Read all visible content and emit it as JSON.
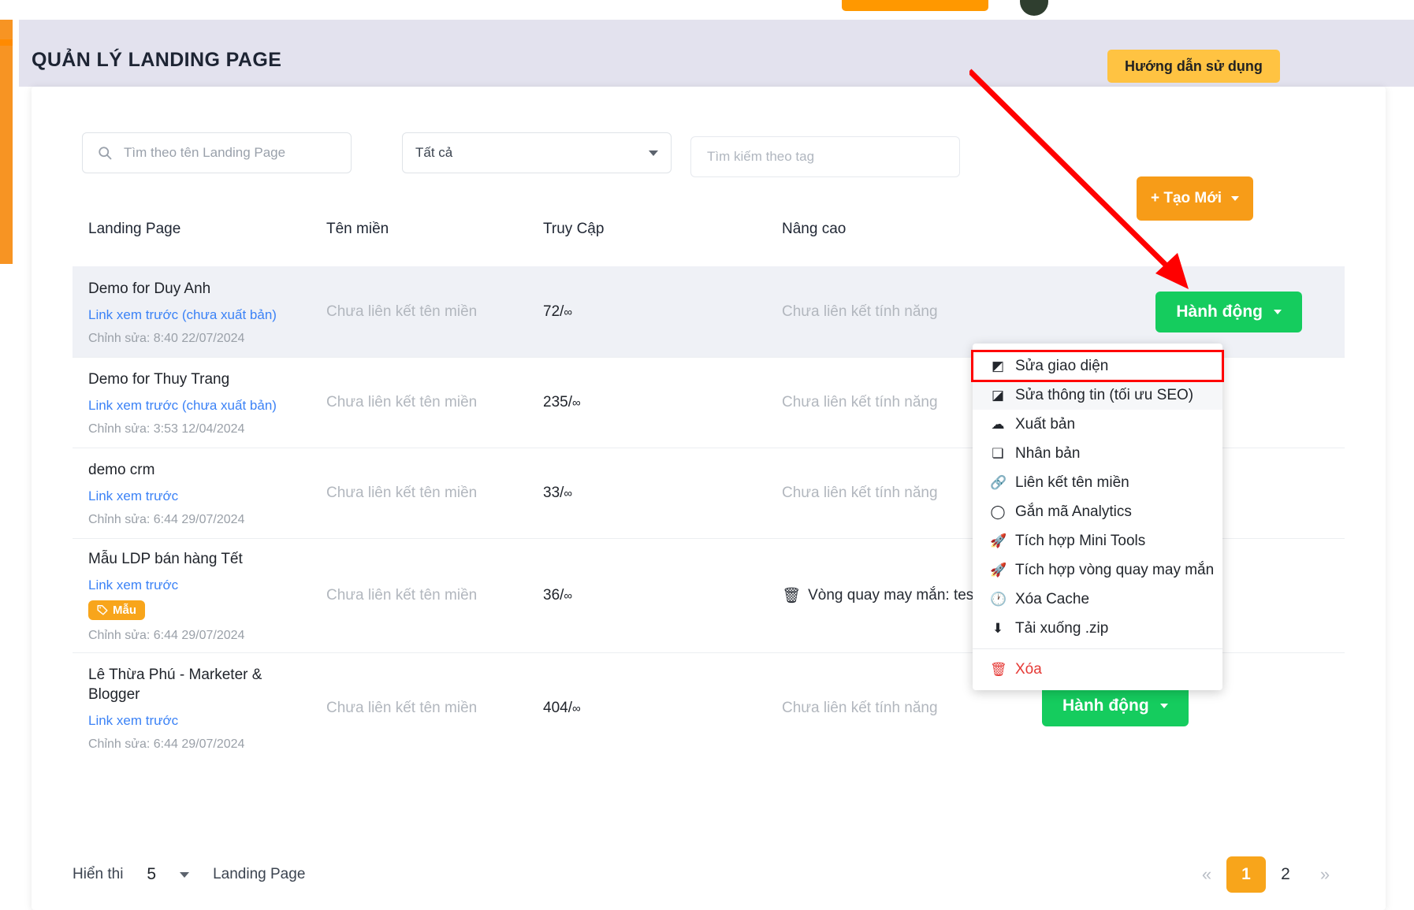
{
  "header": {
    "title": "QUẢN LÝ LANDING PAGE",
    "guide_button": "Hướng dẫn sử dụng"
  },
  "filters": {
    "search_placeholder": "Tìm theo tên Landing Page",
    "search_value": "",
    "search_icon": "search-icon",
    "select_value": "Tất cả",
    "tag_placeholder": "Tìm kiếm theo tag",
    "tag_value": "",
    "create_button": "+ Tạo Mới"
  },
  "table": {
    "columns": [
      "Landing Page",
      "Tên miền",
      "Truy Cập",
      "Nâng cao"
    ],
    "action_button": "Hành động",
    "rows": [
      {
        "name": "Demo for Duy Anh",
        "link": "Link xem trước (chưa xuất bản)",
        "edited": "Chỉnh sửa: 8:40 22/07/2024",
        "domain": "Chưa liên kết tên miền",
        "visits": "72",
        "visits_limit": "∞",
        "advanced": "Chưa liên kết tính năng",
        "tag": "",
        "active": true
      },
      {
        "name": "Demo for Thuy Trang",
        "link": "Link xem trước (chưa xuất bản)",
        "edited": "Chỉnh sửa: 3:53 12/04/2024",
        "domain": "Chưa liên kết tên miền",
        "visits": "235",
        "visits_limit": "∞",
        "advanced": "Chưa liên kết tính năng",
        "tag": "",
        "active": false
      },
      {
        "name": "demo crm",
        "link": "Link xem trước",
        "edited": "Chỉnh sửa: 6:44 29/07/2024",
        "domain": "Chưa liên kết tên miền",
        "visits": "33",
        "visits_limit": "∞",
        "advanced": "Chưa liên kết tính năng",
        "tag": "",
        "active": false
      },
      {
        "name": "Mẫu LDP bán hàng Tết",
        "link": "Link xem trước",
        "edited": "Chỉnh sửa: 6:44 29/07/2024",
        "domain": "Chưa liên kết tên miền",
        "visits": "36",
        "visits_limit": "∞",
        "advanced": "Vòng quay may mắn: test",
        "advanced_icon": "trash-icon",
        "tag": "Mẫu",
        "active": false
      },
      {
        "name": "Lê Thừa Phú - Marketer & Blogger",
        "link": "Link xem trước",
        "edited": "Chỉnh sửa: 6:44 29/07/2024",
        "domain": "Chưa liên kết tên miền",
        "visits": "404",
        "visits_limit": "∞",
        "advanced": "Chưa liên kết tính năng",
        "tag": "",
        "active": false
      }
    ]
  },
  "menu": {
    "items": [
      {
        "label": "Sửa giao diện",
        "icon": "edit-interface-icon",
        "highlighted": true
      },
      {
        "label": "Sửa thông tin (tối ưu SEO)",
        "icon": "edit-info-icon",
        "hovered": true
      },
      {
        "label": "Xuất bản",
        "icon": "cloud-upload-icon"
      },
      {
        "label": "Nhân bản",
        "icon": "duplicate-icon"
      },
      {
        "label": "Liên kết tên miền",
        "icon": "link-icon"
      },
      {
        "label": "Gắn mã Analytics",
        "icon": "analytics-icon"
      },
      {
        "label": "Tích hợp Mini Tools",
        "icon": "rocket-icon"
      },
      {
        "label": "Tích hợp vòng quay may mắn",
        "icon": "rocket-icon"
      },
      {
        "label": "Xóa Cache",
        "icon": "clock-icon"
      },
      {
        "label": "Tải xuống .zip",
        "icon": "download-icon"
      }
    ],
    "danger_item": {
      "label": "Xóa",
      "icon": "trash-icon"
    }
  },
  "footer": {
    "show_label": "Hiển thi",
    "show_count": "5",
    "show_unit": "Landing Page",
    "pagination": {
      "first": "«",
      "last": "»",
      "pages": [
        "1",
        "2"
      ],
      "current": "1"
    }
  },
  "colors": {
    "accent_orange": "#f79c18",
    "action_green": "#15cc5e",
    "guide_yellow": "#ffc342",
    "link_blue": "#3b82f6",
    "annotation_red": "#ff0000",
    "header_band": "#e3e2ee"
  }
}
